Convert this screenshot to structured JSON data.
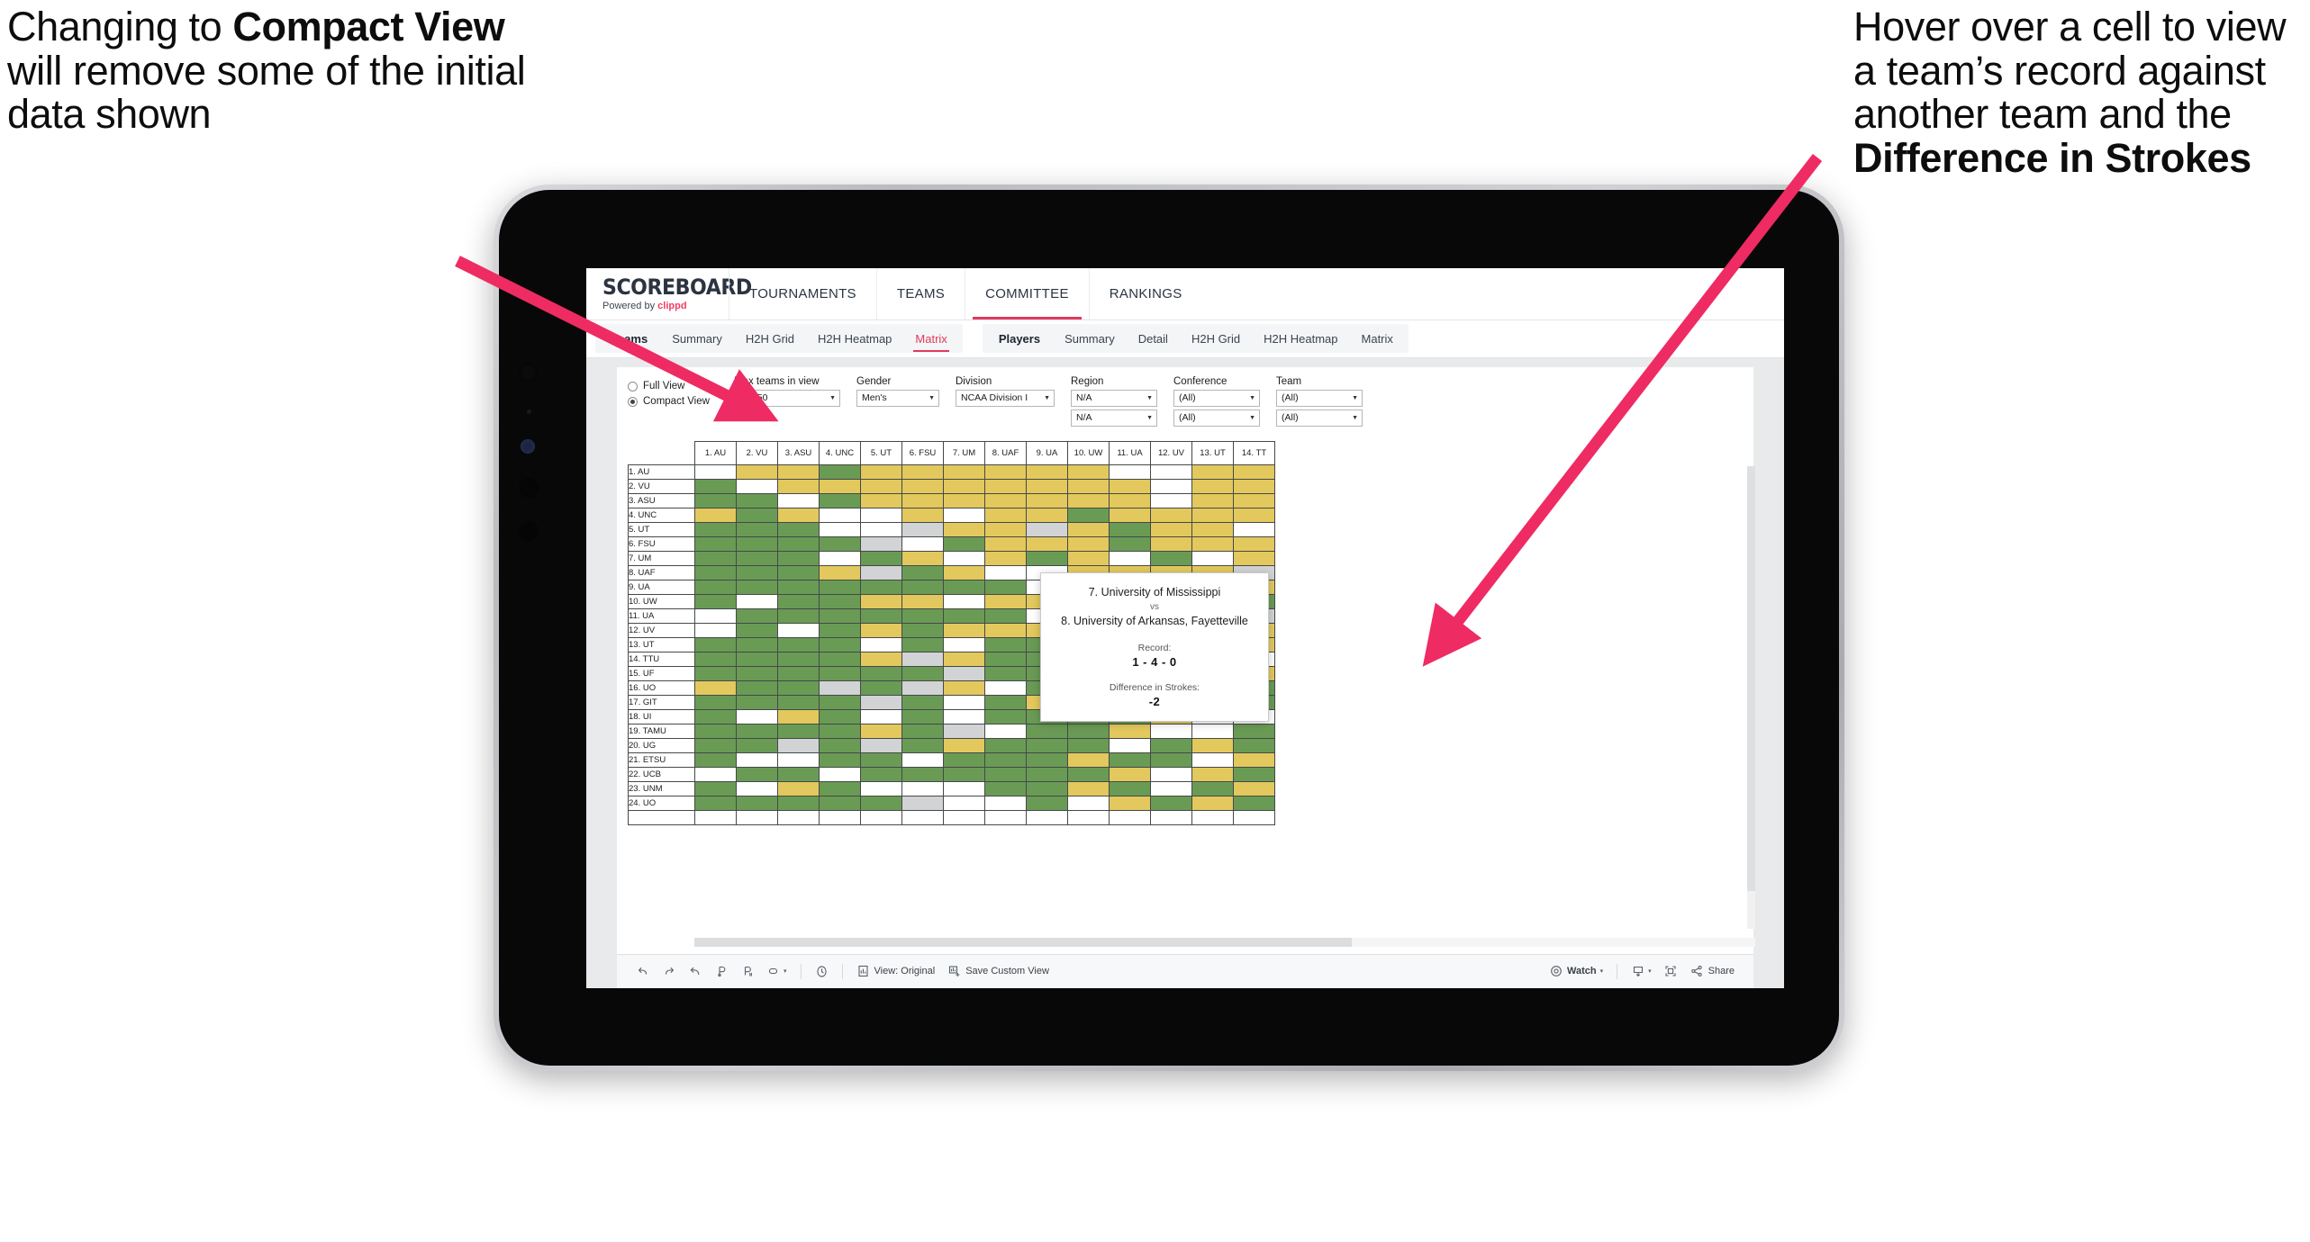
{
  "annotations": {
    "left": {
      "pre": "Changing to ",
      "bold": "Compact View",
      "post": " will remove some of the initial data shown"
    },
    "right": {
      "pre": "Hover over a cell to view a team’s record against another team and the ",
      "bold": "Difference in Strokes",
      "post": ""
    },
    "arrow_color": "#ef2b63"
  },
  "device": {
    "type": "tablet"
  },
  "app": {
    "logo": {
      "title": "SCOREBOARD",
      "powered_prefix": "Powered by ",
      "brand": "clippd"
    },
    "topnav": [
      {
        "label": "TOURNAMENTS",
        "active": false
      },
      {
        "label": "TEAMS",
        "active": false
      },
      {
        "label": "COMMITTEE",
        "active": true
      },
      {
        "label": "RANKINGS",
        "active": false
      }
    ],
    "subnav": [
      {
        "group": "Teams",
        "items": [
          {
            "label": "Summary",
            "active": false
          },
          {
            "label": "H2H Grid",
            "active": false
          },
          {
            "label": "H2H Heatmap",
            "active": false
          },
          {
            "label": "Matrix",
            "active": true
          }
        ]
      },
      {
        "group": "Players",
        "items": [
          {
            "label": "Summary",
            "active": false
          },
          {
            "label": "Detail",
            "active": false
          },
          {
            "label": "H2H Grid",
            "active": false
          },
          {
            "label": "H2H Heatmap",
            "active": false
          },
          {
            "label": "Matrix",
            "active": false
          }
        ]
      }
    ],
    "filters": {
      "view_mode": {
        "options": [
          "Full View",
          "Compact View"
        ],
        "selected": "Compact View"
      },
      "controls": [
        {
          "label": "Max teams in view",
          "values": [
            "Top 50"
          ]
        },
        {
          "label": "Gender",
          "values": [
            "Men's"
          ]
        },
        {
          "label": "Division",
          "values": [
            "NCAA Division I"
          ]
        },
        {
          "label": "Region",
          "values": [
            "N/A",
            "N/A"
          ]
        },
        {
          "label": "Conference",
          "values": [
            "(All)",
            "(All)"
          ]
        },
        {
          "label": "Team",
          "values": [
            "(All)",
            "(All)"
          ]
        }
      ]
    },
    "matrix": {
      "column_headers": [
        "1. AU",
        "2. VU",
        "3. ASU",
        "4. UNC",
        "5. UT",
        "6. FSU",
        "7. UM",
        "8. UAF",
        "9. UA",
        "10. UW",
        "11. UA",
        "12. UV",
        "13. UT",
        "14. TT"
      ],
      "row_headers": [
        "1. AU",
        "2. VU",
        "3. ASU",
        "4. UNC",
        "5. UT",
        "6. FSU",
        "7. UM",
        "8. UAF",
        "9. UA",
        "10. UW",
        "11. UA",
        "12. UV",
        "13. UT",
        "14. TTU",
        "15. UF",
        "16. UO",
        "17. GIT",
        "18. UI",
        "19. TAMU",
        "20. UG",
        "21. ETSU",
        "22. UCB",
        "23. UNM",
        "24. UO"
      ],
      "legend_colors": {
        "win": "#6a9b55",
        "loss": "#e3c95d",
        "none": "#ffffff",
        "tie": "#d2d3d5"
      },
      "cells": [
        [
          "w",
          "y",
          "y",
          "g",
          "y",
          "y",
          "y",
          "y",
          "y",
          "y",
          "w",
          "w",
          "y",
          "y"
        ],
        [
          "g",
          "w",
          "y",
          "y",
          "y",
          "y",
          "y",
          "y",
          "y",
          "y",
          "y",
          "w",
          "y",
          "y"
        ],
        [
          "g",
          "g",
          "w",
          "g",
          "y",
          "y",
          "y",
          "y",
          "y",
          "y",
          "y",
          "w",
          "y",
          "y"
        ],
        [
          "y",
          "g",
          "y",
          "w",
          "w",
          "y",
          "w",
          "y",
          "y",
          "g",
          "y",
          "y",
          "y",
          "y"
        ],
        [
          "g",
          "g",
          "g",
          "w",
          "w",
          "a",
          "y",
          "y",
          "a",
          "y",
          "g",
          "y",
          "y",
          "w"
        ],
        [
          "g",
          "g",
          "g",
          "g",
          "a",
          "w",
          "g",
          "y",
          "y",
          "y",
          "g",
          "y",
          "y",
          "y"
        ],
        [
          "g",
          "g",
          "g",
          "w",
          "g",
          "y",
          "w",
          "y",
          "g",
          "y",
          "w",
          "g",
          "w",
          "y"
        ],
        [
          "g",
          "g",
          "g",
          "y",
          "a",
          "g",
          "y",
          "w",
          "w",
          "y",
          "y",
          "y",
          "y",
          "a"
        ],
        [
          "g",
          "g",
          "g",
          "g",
          "g",
          "g",
          "g",
          "g",
          "w",
          "y",
          "g",
          "y",
          "a",
          "y"
        ],
        [
          "g",
          "w",
          "g",
          "g",
          "y",
          "y",
          "w",
          "y",
          "y",
          "w",
          "y",
          "y",
          "a",
          "g"
        ],
        [
          "w",
          "g",
          "g",
          "g",
          "g",
          "g",
          "g",
          "g",
          "w",
          "g",
          "w",
          "y",
          "a",
          "a"
        ],
        [
          "w",
          "g",
          "w",
          "g",
          "y",
          "g",
          "y",
          "y",
          "y",
          "y",
          "g",
          "w",
          "y",
          "y"
        ],
        [
          "g",
          "g",
          "g",
          "g",
          "w",
          "g",
          "w",
          "g",
          "g",
          "y",
          "y",
          "y",
          "w",
          "y"
        ],
        [
          "g",
          "g",
          "g",
          "g",
          "y",
          "a",
          "y",
          "g",
          "g",
          "y",
          "a",
          "g",
          "y",
          "w"
        ],
        [
          "g",
          "g",
          "g",
          "g",
          "g",
          "g",
          "a",
          "g",
          "g",
          "g",
          "g",
          "y",
          "a",
          "y"
        ],
        [
          "y",
          "g",
          "g",
          "a",
          "g",
          "a",
          "y",
          "w",
          "g",
          "a",
          "g",
          "y",
          "w",
          "g"
        ],
        [
          "g",
          "g",
          "g",
          "g",
          "a",
          "g",
          "w",
          "g",
          "y",
          "w",
          "g",
          "w",
          "y",
          "g"
        ],
        [
          "g",
          "w",
          "y",
          "g",
          "w",
          "g",
          "w",
          "g",
          "g",
          "g",
          "g",
          "y",
          "w",
          "w"
        ],
        [
          "g",
          "g",
          "g",
          "g",
          "y",
          "g",
          "a",
          "w",
          "g",
          "g",
          "y",
          "w",
          "w",
          "g"
        ],
        [
          "g",
          "g",
          "a",
          "g",
          "a",
          "g",
          "y",
          "g",
          "g",
          "g",
          "w",
          "g",
          "y",
          "g"
        ],
        [
          "g",
          "w",
          "w",
          "g",
          "g",
          "w",
          "g",
          "g",
          "g",
          "y",
          "g",
          "g",
          "w",
          "y"
        ],
        [
          "w",
          "g",
          "g",
          "w",
          "g",
          "g",
          "g",
          "g",
          "g",
          "g",
          "y",
          "w",
          "y",
          "g"
        ],
        [
          "g",
          "w",
          "y",
          "g",
          "w",
          "w",
          "w",
          "g",
          "g",
          "y",
          "g",
          "w",
          "g",
          "y"
        ],
        [
          "g",
          "g",
          "g",
          "g",
          "g",
          "a",
          "w",
          "w",
          "g",
          "w",
          "y",
          "g",
          "y",
          "g"
        ]
      ]
    },
    "tooltip": {
      "team_a": "7. University of Mississippi",
      "vs": "vs",
      "team_b": "8. University of Arkansas, Fayetteville",
      "record_label": "Record:",
      "record_value": "1 - 4 - 0",
      "diff_label": "Difference in Strokes:",
      "diff_value": "-2"
    },
    "toolbar": {
      "items": [
        {
          "name": "undo",
          "icon": "undo-icon",
          "label": ""
        },
        {
          "name": "redo",
          "icon": "redo-icon",
          "label": ""
        },
        {
          "name": "revert",
          "icon": "revert-icon",
          "label": ""
        },
        {
          "name": "refresh",
          "icon": "refresh-icon",
          "label": ""
        },
        {
          "name": "pause",
          "icon": "pause-updates-icon",
          "label": ""
        },
        {
          "name": "highlight",
          "icon": "highlight-icon",
          "label": "",
          "caret": true
        }
      ],
      "alerts_icon": "alerts-icon",
      "view_original_label": "View: Original",
      "save_custom_view_label": "Save Custom View",
      "watch_label": "Watch",
      "download_icon": "download-icon",
      "fullscreen_icon": "fullscreen-icon",
      "share_label": "Share"
    }
  }
}
